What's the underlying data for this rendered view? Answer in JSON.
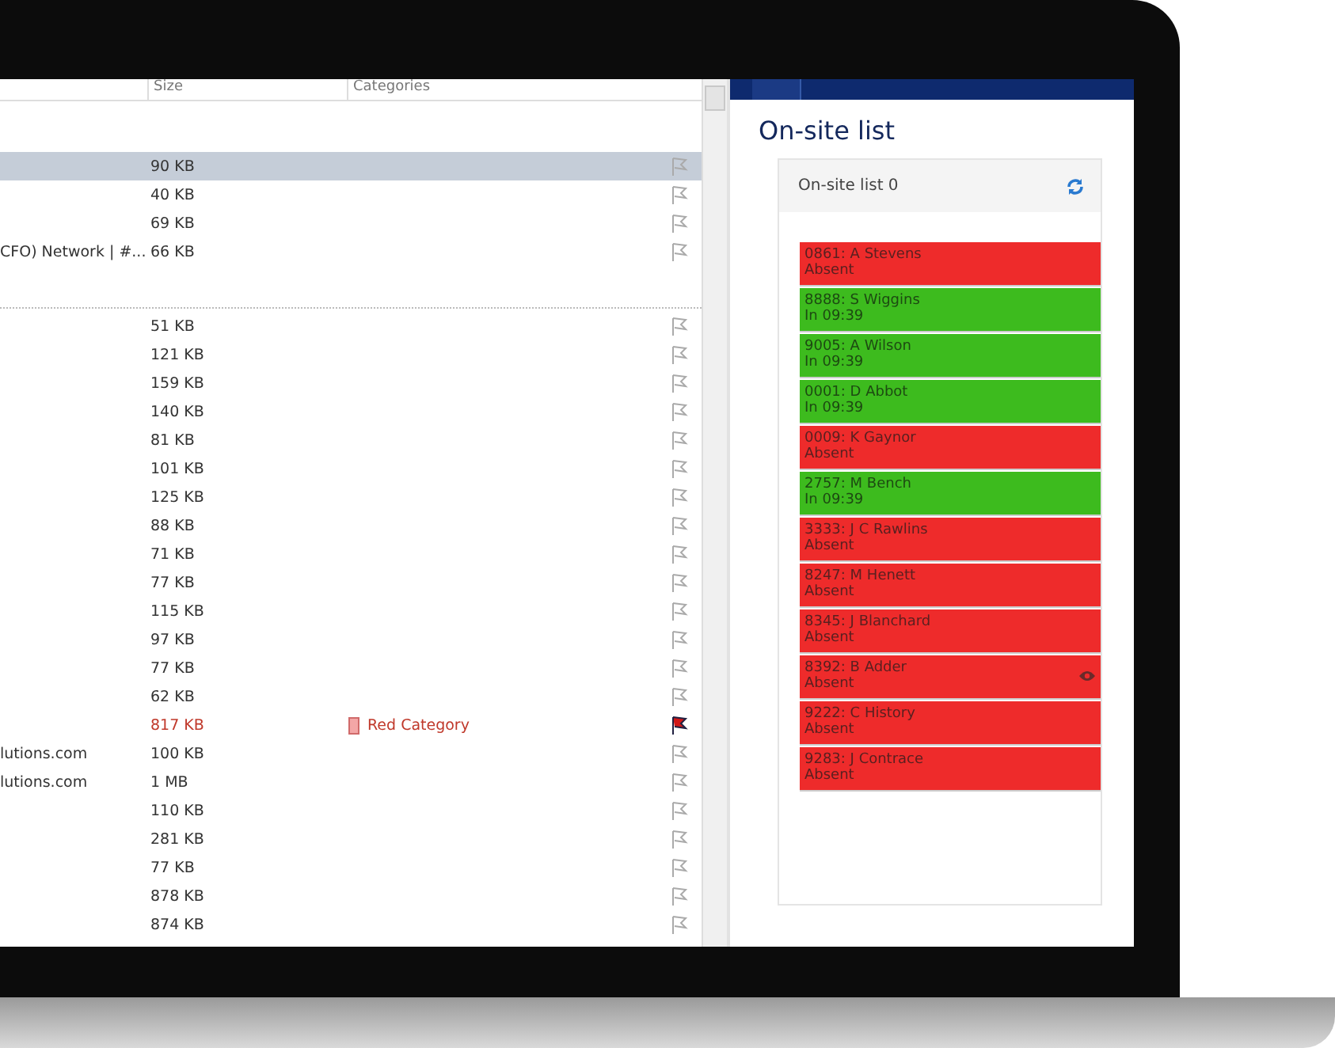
{
  "mail_list": {
    "columns": [
      "Size",
      "Categories"
    ],
    "rows_top": [
      {
        "size": "90 KB",
        "flagged": false,
        "selected": true
      },
      {
        "size": "40 KB",
        "flagged": false,
        "selected": false
      },
      {
        "size": "69 KB",
        "flagged": false,
        "selected": false
      },
      {
        "subject": "CFO) Network |  #...",
        "size": "66 KB",
        "flagged": false,
        "selected": false
      }
    ],
    "rows": [
      {
        "size": "51 KB",
        "flagged": false,
        "selected": false
      },
      {
        "size": "121 KB",
        "flagged": false,
        "selected": false
      },
      {
        "size": "159 KB",
        "flagged": false,
        "selected": false
      },
      {
        "size": "140 KB",
        "flagged": false,
        "selected": false
      },
      {
        "size": "81 KB",
        "flagged": false,
        "selected": false
      },
      {
        "size": "101 KB",
        "flagged": false,
        "selected": false
      },
      {
        "size": "125 KB",
        "flagged": false,
        "selected": false
      },
      {
        "size": "88 KB",
        "flagged": false,
        "selected": false
      },
      {
        "size": "71 KB",
        "flagged": false,
        "selected": false
      },
      {
        "size": "77 KB",
        "flagged": false,
        "selected": false
      },
      {
        "size": "115 KB",
        "flagged": false,
        "selected": false
      },
      {
        "size": "97 KB",
        "flagged": false,
        "selected": false
      },
      {
        "size": "77 KB",
        "flagged": false,
        "selected": false
      },
      {
        "size": "62 KB",
        "flagged": false,
        "selected": false
      },
      {
        "size": "817 KB",
        "category": "Red Category",
        "flagged": true,
        "selected": false
      },
      {
        "subject": "lutions.com",
        "size": "100 KB",
        "flagged": false,
        "selected": false
      },
      {
        "subject": "lutions.com",
        "size": "1 MB",
        "flagged": false,
        "selected": false
      },
      {
        "size": "110 KB",
        "flagged": false,
        "selected": false
      },
      {
        "size": "281 KB",
        "flagged": false,
        "selected": false
      },
      {
        "size": "77 KB",
        "flagged": false,
        "selected": false
      },
      {
        "size": "878 KB",
        "flagged": false,
        "selected": false
      },
      {
        "size": "874 KB",
        "flagged": false,
        "selected": false
      }
    ]
  },
  "onsite": {
    "title": "On-site list",
    "card_title": "On-site list 0",
    "people": [
      {
        "name": "0861: A Stevens",
        "status": "Absent",
        "color": "#ee2b2b",
        "watched": false
      },
      {
        "name": "8888: S Wiggins",
        "status": "In 09:39",
        "color": "#3dbb1e",
        "watched": false
      },
      {
        "name": "9005: A Wilson",
        "status": "In 09:39",
        "color": "#3dbb1e",
        "watched": false
      },
      {
        "name": "0001: D Abbot",
        "status": "In 09:39",
        "color": "#3dbb1e",
        "watched": false
      },
      {
        "name": "0009: K Gaynor",
        "status": "Absent",
        "color": "#ee2b2b",
        "watched": false
      },
      {
        "name": "2757: M Bench",
        "status": "In 09:39",
        "color": "#3dbb1e",
        "watched": false
      },
      {
        "name": "3333: J C Rawlins",
        "status": "Absent",
        "color": "#ee2b2b",
        "watched": false
      },
      {
        "name": "8247: M Henett",
        "status": "Absent",
        "color": "#ee2b2b",
        "watched": false
      },
      {
        "name": "8345: J Blanchard",
        "status": "Absent",
        "color": "#ee2b2b",
        "watched": false
      },
      {
        "name": "8392: B Adder",
        "status": "Absent",
        "color": "#ee2b2b",
        "watched": true
      },
      {
        "name": "9222: C History",
        "status": "Absent",
        "color": "#ee2b2b",
        "watched": false
      },
      {
        "name": "9283: J Contrace",
        "status": "Absent",
        "color": "#ee2b2b",
        "watched": false
      }
    ]
  }
}
